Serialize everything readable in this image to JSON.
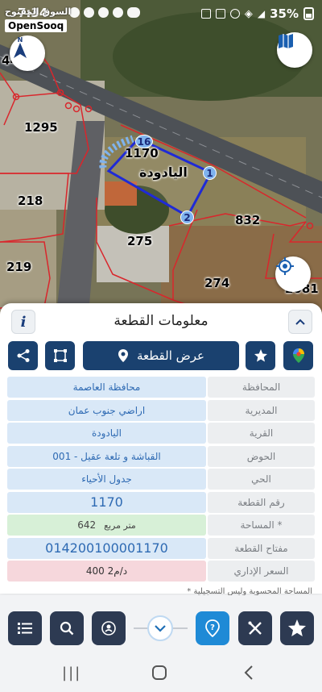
{
  "status_bar": {
    "time": "7:34",
    "battery": "35%"
  },
  "watermark": {
    "arabic": "السوق المفتوح",
    "english": "OpenSooq"
  },
  "map": {
    "parcel_labels": [
      "1295",
      "218",
      "219",
      "275",
      "274",
      "832",
      "1170",
      "2081"
    ],
    "edge_label_left": "44",
    "village_label": "اليادودة",
    "vertex_labels": [
      "1",
      "2",
      "16"
    ]
  },
  "sheet": {
    "title": "معلومات القطعة",
    "show_parcel_label": "عرض القطعة",
    "fields": [
      {
        "label": "المحافظة",
        "value": "محافظة العاصمة"
      },
      {
        "label": "المديرية",
        "value": "اراضي جنوب عمان"
      },
      {
        "label": "القرية",
        "value": "اليادودة"
      },
      {
        "label": "الحوض",
        "value": "القباشة و تلعة عقيل - 001"
      },
      {
        "label": "الحي",
        "value": "جدول الأحياء"
      },
      {
        "label": "رقم القطعة",
        "value": "1170"
      },
      {
        "label": "المساحة *",
        "value": "642",
        "unit": "متر مربع"
      },
      {
        "label": "مفتاح القطعة",
        "value": "014200100001170"
      },
      {
        "label": "السعر الإداري",
        "value": "400 د/م2"
      }
    ],
    "note": "* المساحة المحسوبة وليس التسجيلية"
  },
  "colors": {
    "navy": "#1a416f",
    "active": "#1f8ad6",
    "parcel_line": "#d9262c",
    "selection": "#1f2ad6"
  }
}
